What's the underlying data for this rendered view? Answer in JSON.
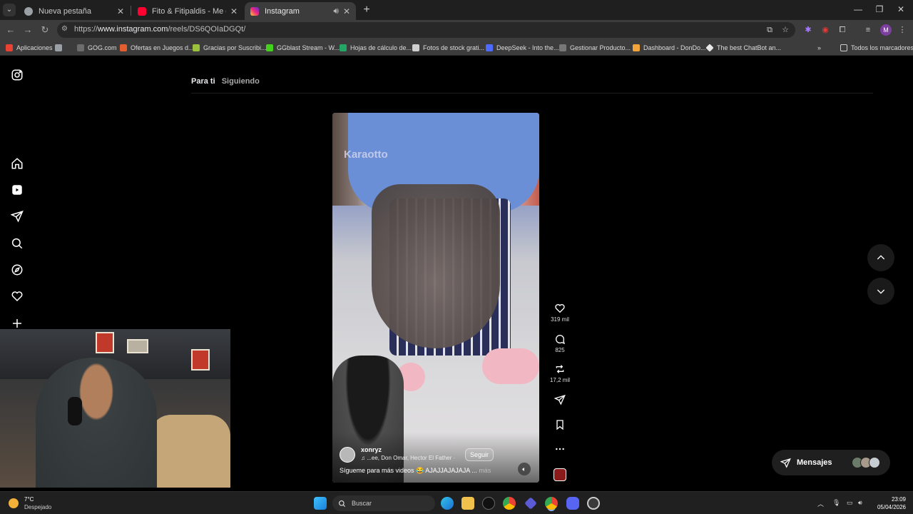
{
  "browser": {
    "tabs": [
      {
        "title": "Nueva pestaña",
        "favicon_color": "#9aa0a6",
        "icon": "chrome-icon"
      },
      {
        "title": "Fito & Fitipaldis - Me equivocaría",
        "favicon_color": "#ff0033",
        "icon": "youtube-icon"
      },
      {
        "title": "Instagram",
        "favicon_color": "#d6249f",
        "icon": "instagram-icon"
      }
    ],
    "url_prefix": "https://",
    "url_domain": "www.instagram.com",
    "url_path": "/reels/DS6QOIaDGQt/",
    "profile_initial": "M",
    "bookmarks": [
      {
        "label": "Aplicaciones",
        "color": "#e94235"
      },
      {
        "label": "",
        "color": "#9aa0a6"
      },
      {
        "label": "GOG.com",
        "color": "#6c6c6c"
      },
      {
        "label": "Ofertas en Juegos d...",
        "color": "#e35d2f"
      },
      {
        "label": "Gracias por Suscribi...",
        "color": "#9ac23c"
      },
      {
        "label": "GGblast Stream - W...",
        "color": "#43d11b"
      },
      {
        "label": "Hojas de cálculo de...",
        "color": "#23a566"
      },
      {
        "label": "Fotos de stock grati...",
        "color": "#cfcfcf"
      },
      {
        "label": "DeepSeek - Into the...",
        "color": "#4d6bfe"
      },
      {
        "label": "Gestionar Producto...",
        "color": "#777777"
      },
      {
        "label": "Dashboard - DonDo...",
        "color": "#f2a33a"
      },
      {
        "label": "The best ChatBot an...",
        "color": "#e8e8e8"
      }
    ],
    "all_bookmarks": "Todos los marcadores"
  },
  "instagram": {
    "feed_tabs": [
      "Para ti",
      "Siguiendo"
    ],
    "reel": {
      "watermark": "Karaotto",
      "username": "xonryz",
      "music": "...ee, Don Omar, Hector El Father ·",
      "follow": "Seguir",
      "caption": "Sígueme para más videos 😂 AJAJJAJAJAJA ...",
      "more": "más"
    },
    "actions": {
      "likes": "319 mil",
      "comments": "825",
      "reposts": "17,2 mil"
    },
    "messages_label": "Mensajes"
  },
  "taskbar": {
    "temperature": "7°C",
    "weather": "Despejado",
    "search_placeholder": "Buscar",
    "time": "23:09",
    "date": "05/04/2026"
  }
}
